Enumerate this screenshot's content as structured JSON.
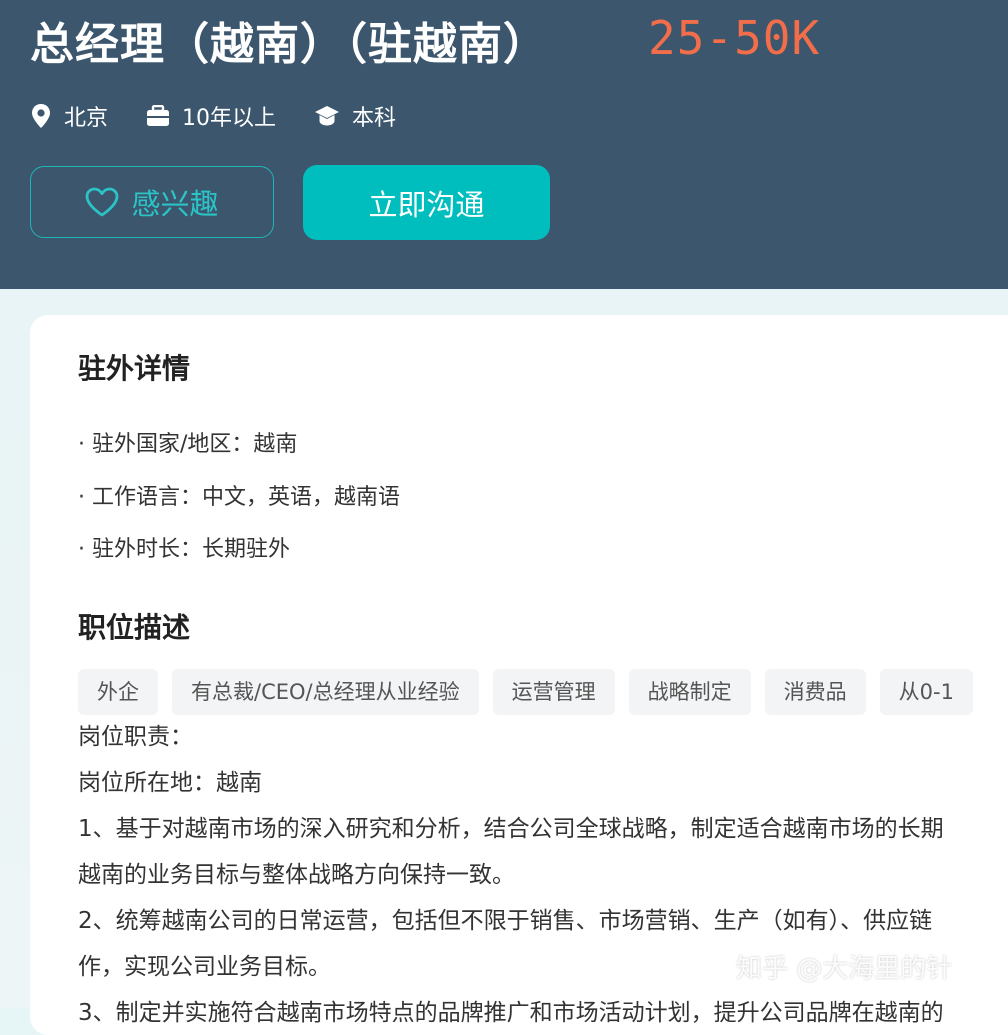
{
  "header": {
    "job_title": "总经理（越南）（驻越南）",
    "salary": "25-50K",
    "location": "北京",
    "experience": "10年以上",
    "education": "本科",
    "interest_button": "感兴趣",
    "chat_button": "立即沟通",
    "icons": {
      "location": "location-pin-icon",
      "experience": "briefcase-icon",
      "education": "graduation-cap-icon",
      "interest": "heart-outline-icon"
    },
    "colors": {
      "banner": "#3b566d",
      "salary": "#f26e4a",
      "accent": "#00bebd"
    }
  },
  "overseas": {
    "title": "驻外详情",
    "lines": [
      "· 驻外国家/地区：越南",
      "· 工作语言：中文，英语，越南语",
      "· 驻外时长：长期驻外"
    ]
  },
  "description": {
    "title": "职位描述",
    "tags": [
      "外企",
      "有总裁/CEO/总经理从业经验",
      "运营管理",
      "战略制定",
      "消费品",
      "从0-1"
    ],
    "lines": [
      "岗位职责：",
      "岗位所在地：越南",
      "1、基于对越南市场的深入研究和分析，结合公司全球战略，制定适合越南市场的长期",
      "越南的业务目标与整体战略方向保持一致。",
      "2、统筹越南公司的日常运营，包括但不限于销售、市场营销、生产（如有）、供应链",
      "作，实现公司业务目标。",
      "3、制定并实施符合越南市场特点的品牌推广和市场活动计划，提升公司品牌在越南的"
    ]
  },
  "watermark": "知乎 @大海里的针"
}
